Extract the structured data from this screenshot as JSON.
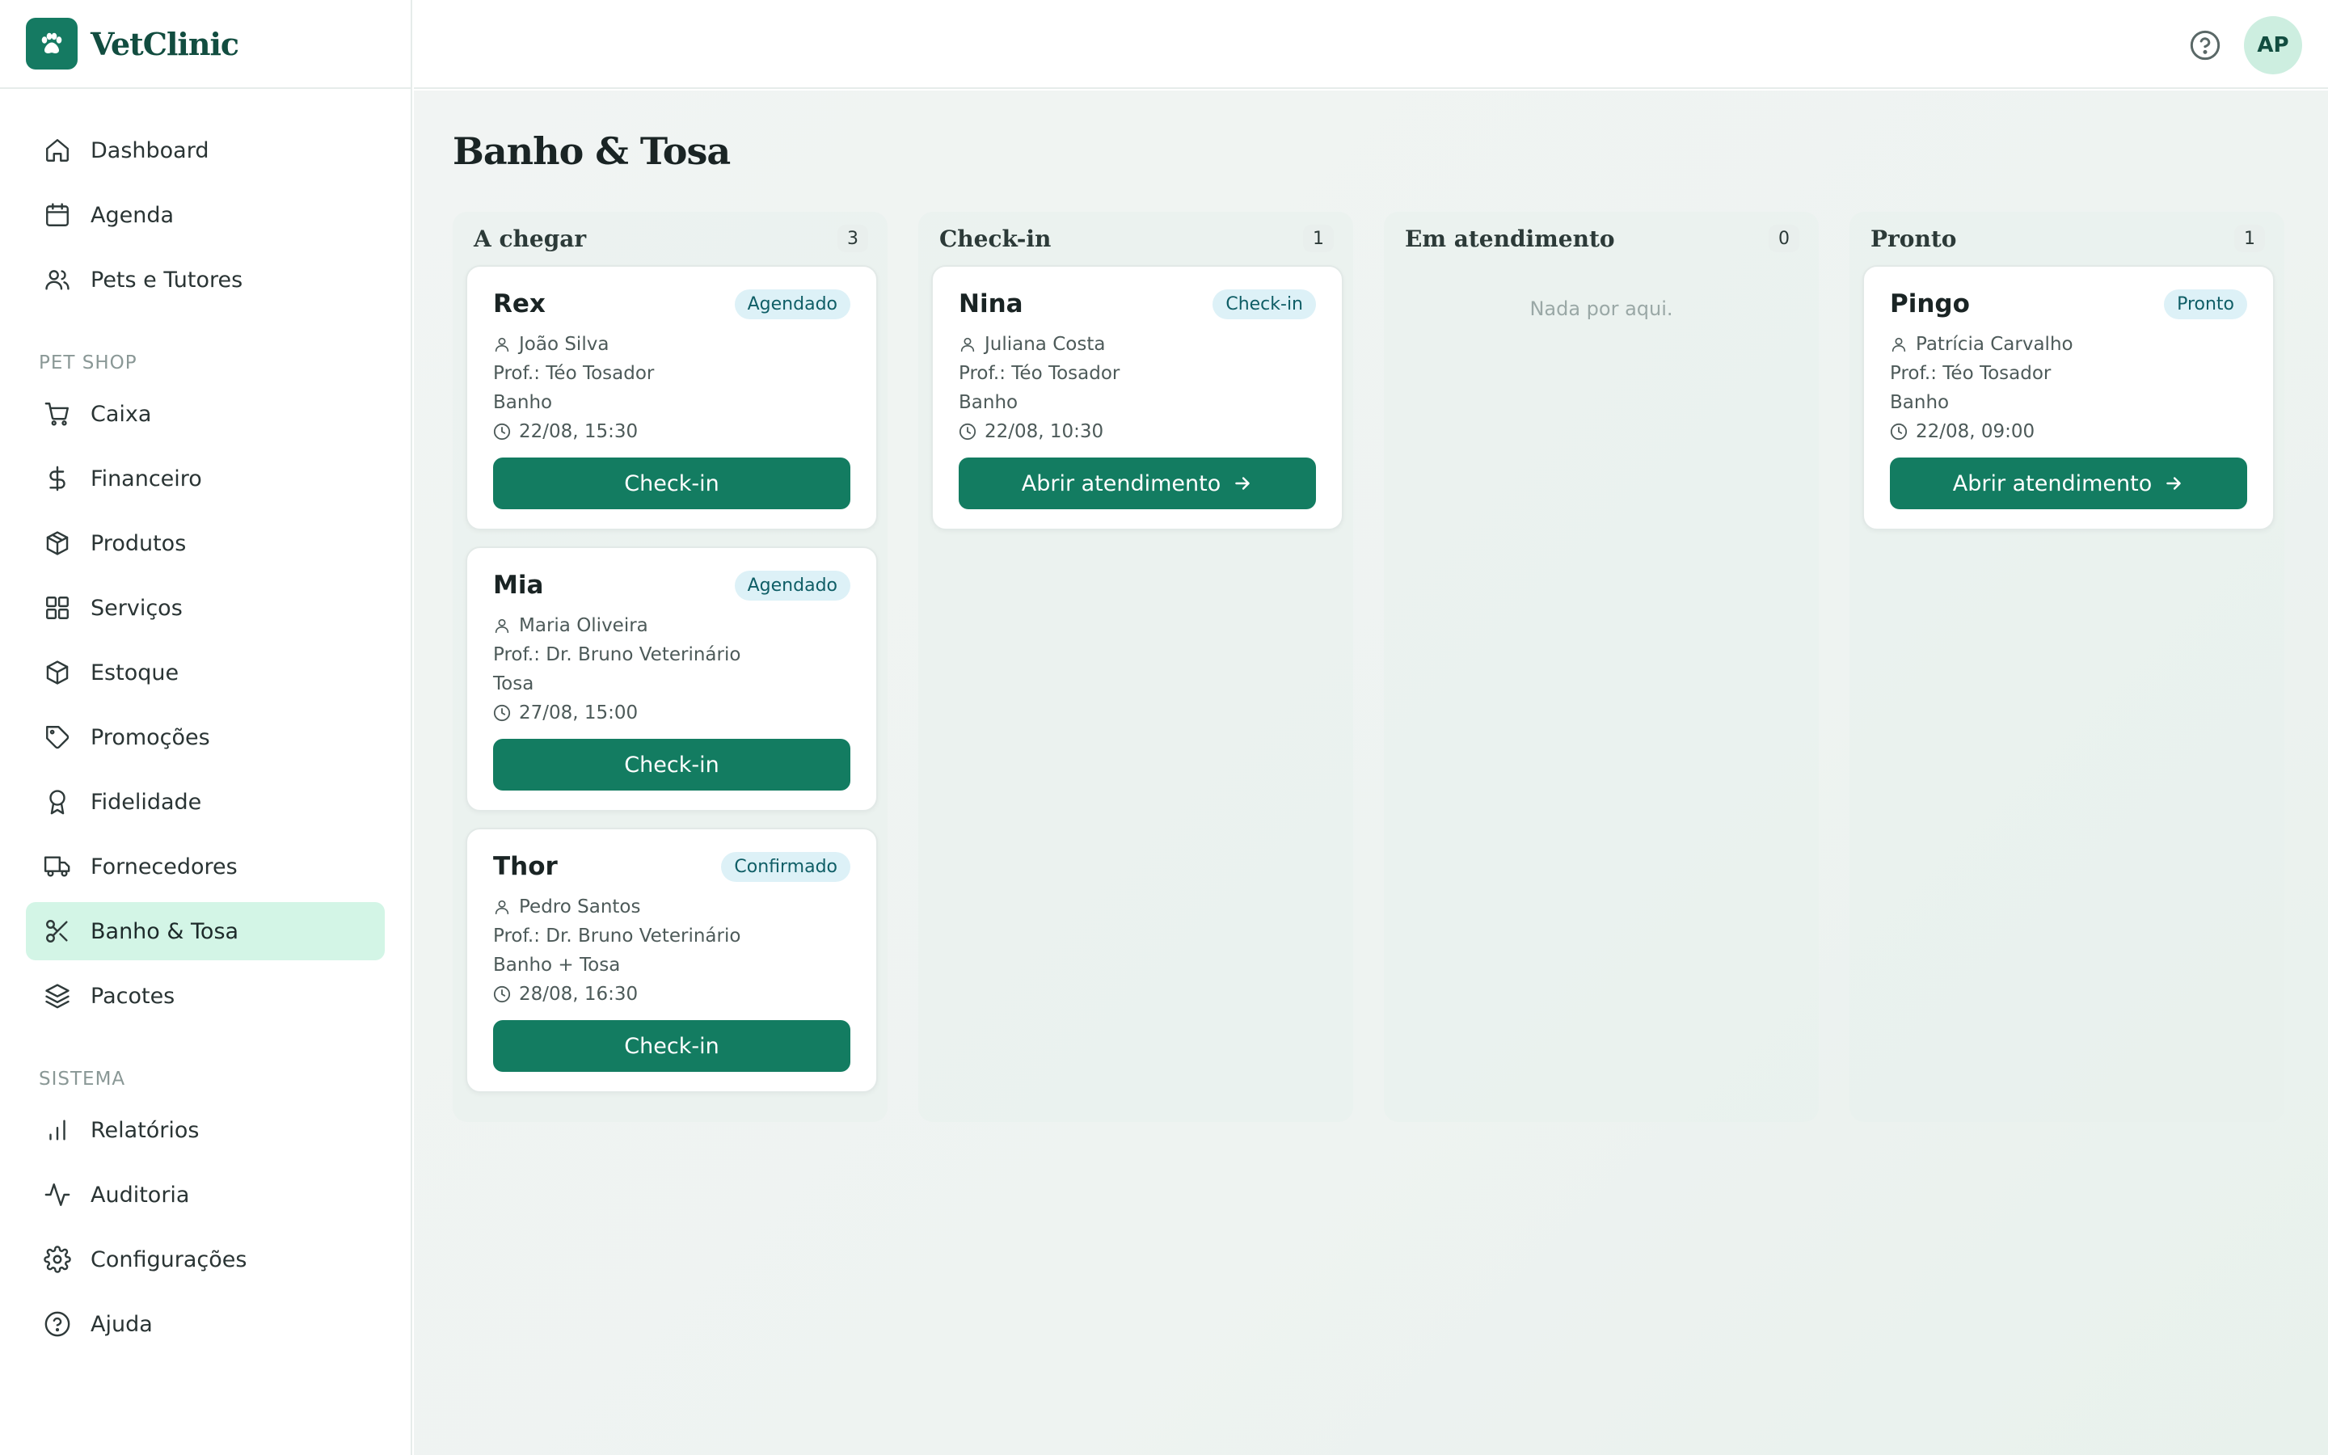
{
  "app": {
    "name": "VetClinic",
    "user_initials": "AP"
  },
  "sidebar": {
    "main_items": [
      {
        "label": "Dashboard",
        "icon": "home-icon"
      },
      {
        "label": "Agenda",
        "icon": "calendar-icon"
      },
      {
        "label": "Pets e Tutores",
        "icon": "users-icon"
      }
    ],
    "petshop_title": "PET SHOP",
    "petshop_items": [
      {
        "label": "Caixa",
        "icon": "cart-icon"
      },
      {
        "label": "Financeiro",
        "icon": "dollar-icon"
      },
      {
        "label": "Produtos",
        "icon": "package-icon"
      },
      {
        "label": "Serviços",
        "icon": "grid-icon"
      },
      {
        "label": "Estoque",
        "icon": "box-icon"
      },
      {
        "label": "Promoções",
        "icon": "tag-icon"
      },
      {
        "label": "Fidelidade",
        "icon": "award-icon"
      },
      {
        "label": "Fornecedores",
        "icon": "truck-icon"
      },
      {
        "label": "Banho & Tosa",
        "icon": "scissors-icon",
        "active": true
      },
      {
        "label": "Pacotes",
        "icon": "layers-icon"
      }
    ],
    "sistema_title": "SISTEMA",
    "sistema_items": [
      {
        "label": "Relatórios",
        "icon": "bar-chart-icon"
      },
      {
        "label": "Auditoria",
        "icon": "activity-icon"
      },
      {
        "label": "Configurações",
        "icon": "gear-icon"
      },
      {
        "label": "Ajuda",
        "icon": "help-icon"
      }
    ]
  },
  "page": {
    "title": "Banho & Tosa"
  },
  "board": {
    "columns": [
      {
        "title": "A chegar",
        "count": "3",
        "cards": [
          {
            "pet": "Rex",
            "status": "Agendado",
            "tutor": "João Silva",
            "prof": "Prof.: Téo Tosador",
            "service": "Banho",
            "datetime": "22/08, 15:30",
            "action": "Check-in",
            "arrow": false
          },
          {
            "pet": "Mia",
            "status": "Agendado",
            "tutor": "Maria Oliveira",
            "prof": "Prof.: Dr. Bruno Veterinário",
            "service": "Tosa",
            "datetime": "27/08, 15:00",
            "action": "Check-in",
            "arrow": false
          },
          {
            "pet": "Thor",
            "status": "Confirmado",
            "tutor": "Pedro Santos",
            "prof": "Prof.: Dr. Bruno Veterinário",
            "service": "Banho + Tosa",
            "datetime": "28/08, 16:30",
            "action": "Check-in",
            "arrow": false
          }
        ]
      },
      {
        "title": "Check-in",
        "count": "1",
        "cards": [
          {
            "pet": "Nina",
            "status": "Check-in",
            "tutor": "Juliana Costa",
            "prof": "Prof.: Téo Tosador",
            "service": "Banho",
            "datetime": "22/08, 10:30",
            "action": "Abrir atendimento",
            "arrow": true
          }
        ]
      },
      {
        "title": "Em atendimento",
        "count": "0",
        "empty_text": "Nada por aqui.",
        "cards": []
      },
      {
        "title": "Pronto",
        "count": "1",
        "cards": [
          {
            "pet": "Pingo",
            "status": "Pronto",
            "tutor": "Patrícia Carvalho",
            "prof": "Prof.: Téo Tosador",
            "service": "Banho",
            "datetime": "22/08, 09:00",
            "action": "Abrir atendimento",
            "arrow": true
          }
        ]
      }
    ]
  }
}
